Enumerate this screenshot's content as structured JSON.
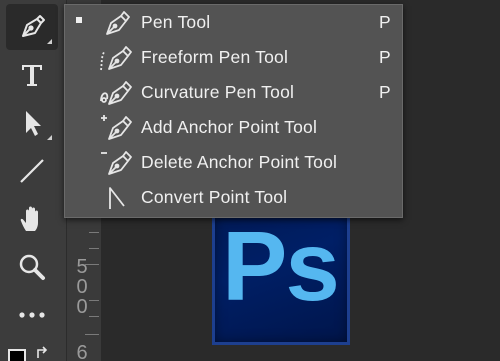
{
  "toolbar": {
    "tools": [
      {
        "name": "pen-tool",
        "icon": "pen-icon",
        "active": true
      },
      {
        "name": "type-tool",
        "icon": "type-icon",
        "active": false
      },
      {
        "name": "path-selection-tool",
        "icon": "arrow-icon",
        "active": false
      },
      {
        "name": "line-tool",
        "icon": "line-icon",
        "active": false
      },
      {
        "name": "hand-tool",
        "icon": "hand-icon",
        "active": false
      },
      {
        "name": "zoom-tool",
        "icon": "magnifier-icon",
        "active": false
      },
      {
        "name": "more-tools",
        "icon": "ellipsis-icon",
        "active": false
      }
    ]
  },
  "ruler": {
    "digits": [
      "5",
      "0",
      "0",
      "6"
    ]
  },
  "flyout": {
    "items": [
      {
        "label": "Pen Tool",
        "shortcut": "P",
        "icon": "pen-icon",
        "selected": true
      },
      {
        "label": "Freeform Pen Tool",
        "shortcut": "P",
        "icon": "freeform-pen-icon",
        "selected": false
      },
      {
        "label": "Curvature Pen Tool",
        "shortcut": "P",
        "icon": "curvature-pen-icon",
        "selected": false
      },
      {
        "label": "Add Anchor Point Tool",
        "shortcut": "",
        "icon": "add-anchor-point-icon",
        "selected": false
      },
      {
        "label": "Delete Anchor Point Tool",
        "shortcut": "",
        "icon": "delete-anchor-point-icon",
        "selected": false
      },
      {
        "label": "Convert Point Tool",
        "shortcut": "",
        "icon": "convert-point-icon",
        "selected": false
      }
    ]
  },
  "logo": {
    "text": "Ps",
    "text_color": "#55b7f0",
    "background_color": "#001f66"
  },
  "colors": {
    "toolbar_bg": "#3c3c3c",
    "menu_bg": "#535353",
    "text": "#f0f0f0"
  }
}
